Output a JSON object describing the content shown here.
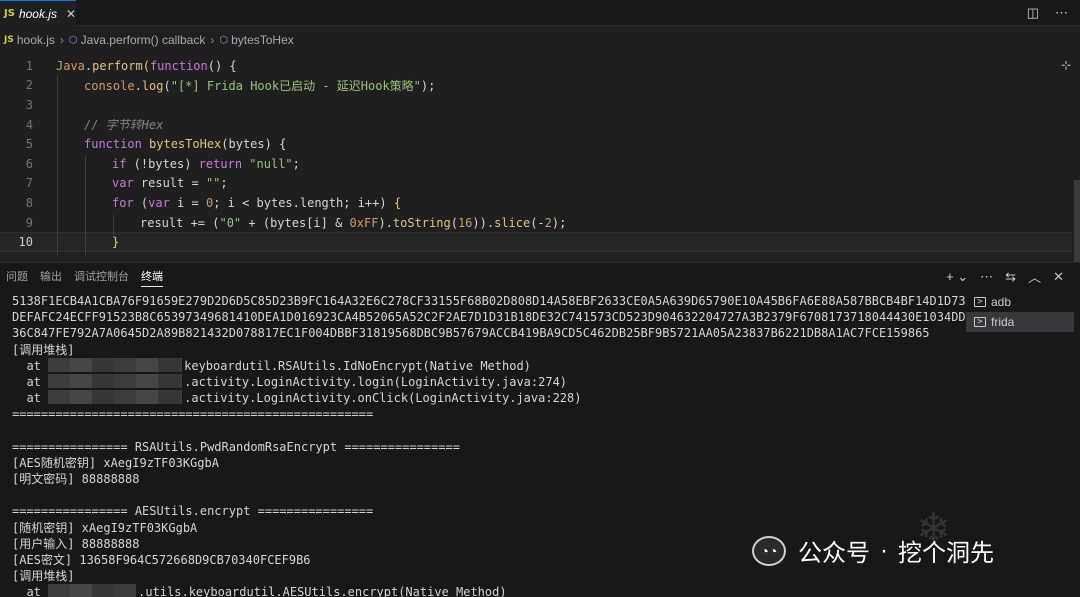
{
  "tab": {
    "badge": "JS",
    "name": "hook.js",
    "close": "✕"
  },
  "breadcrumb": {
    "file_badge": "JS",
    "file": "hook.js",
    "scope": "Java.perform() callback",
    "symbol": "bytesToHex"
  },
  "editor": {
    "line_numbers": [
      "1",
      "2",
      "3",
      "4",
      "5",
      "6",
      "7",
      "8",
      "9",
      "10"
    ],
    "lines": {
      "l1": {
        "a": "Java",
        "b": ".",
        "c": "perform",
        "d": "(",
        "e": "function",
        "f": "() {"
      },
      "l2": {
        "a": "console",
        "b": ".",
        "c": "log",
        "d": "(",
        "e": "\"[*] Frida Hook已启动 - 延迟Hook策略\"",
        "f": ");"
      },
      "l4": {
        "a": "// 字节转Hex"
      },
      "l5": {
        "a": "function",
        "b": " ",
        "c": "bytesToHex",
        "d": "(bytes) {"
      },
      "l6": {
        "a": "if",
        "b": " (!bytes) ",
        "c": "return",
        "d": " ",
        "e": "\"null\"",
        "f": ";"
      },
      "l7": {
        "a": "var",
        "b": " result = ",
        "c": "\"\"",
        "d": ";"
      },
      "l8": {
        "a": "for",
        "b": " (",
        "c": "var",
        "d": " i = ",
        "e": "0",
        "f": "; i < bytes.length; i++) ",
        "g": "{"
      },
      "l9": {
        "a": "result += (",
        "b": "\"0\"",
        "c": " + (bytes[i] & ",
        "d": "0xFF",
        "e": ").",
        "f": "toString",
        "g": "(",
        "h": "16",
        "i": ")).",
        "j": "slice",
        "k": "(-",
        "l": "2",
        "m": ");"
      },
      "l10": {
        "a": "}"
      }
    }
  },
  "panel": {
    "tabs": [
      "问题",
      "输出",
      "调试控制台",
      "终端"
    ],
    "active_tab": "终端",
    "terminal_lines": [
      "5138F1ECB4A1CBA76F91659E279D2D6D5C85D23B9FC164A32E6C278CF33155F68B02D808D14A58EBF2633CE0A5A639D65790E10A45B6FA6E88A587BBCB4BF14D1D73",
      "DEFAFC24ECFF91523B8C65397349681410DEA1D016923CA4B52065A52C2F2AE7D1D31B18DE32C741573CD523D904632204727A3B2379F6708173718044430E1034DD",
      "36C847FE792A7A0645D2A89B821432D078817EC1F004DBBF31819568DBC9B57679ACCB419BA9CD5C462DB25BF9B5721AA05A23837B6221DB8A1AC7FCE159865",
      "[调用堆栈]"
    ],
    "stack1": [
      {
        "prefix": "  at ",
        "suffix": "keyboardutil.RSAUtils.IdNoEncrypt(Native Method)"
      },
      {
        "prefix": "  at ",
        "suffix": ".activity.LoginActivity.login(LoginActivity.java:274)"
      },
      {
        "prefix": "  at ",
        "suffix": ".activity.LoginActivity.onClick(LoginActivity.java:228)"
      }
    ],
    "terminal_lines_2": [
      "==================================================",
      "",
      "================ RSAUtils.PwdRandomRsaEncrypt ================",
      "[AES随机密钥] xAegI9zTF03KGgbA",
      "[明文密码] 88888888",
      "",
      "================ AESUtils.encrypt ================",
      "[随机密钥] xAegI9zTF03KGgbA",
      "[用户输入] 88888888",
      "[AES密文] 13658F964C572668D9CB70340FCEF9B6",
      "[调用堆栈]"
    ],
    "stack2": {
      "prefix": "  at ",
      "suffix": ".utils.keyboardutil.AESUtils.encrypt(Native Method)"
    },
    "processes": [
      "adb",
      "frida"
    ],
    "active_process": "frida"
  },
  "watermark": {
    "text": "公众号",
    "dot": "·",
    "name": "挖个洞先"
  }
}
